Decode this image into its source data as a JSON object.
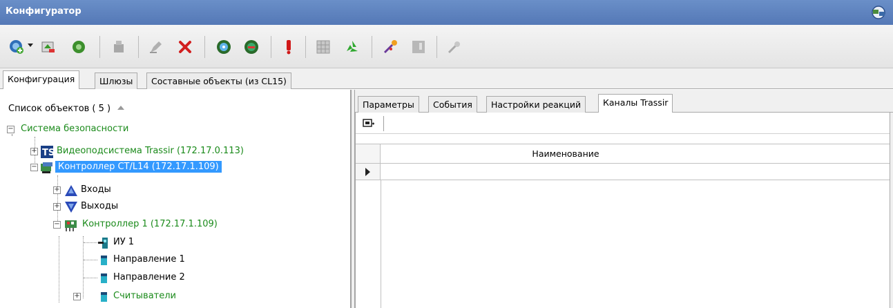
{
  "window": {
    "title": "Конфигуратор",
    "icon": "app-network-icon"
  },
  "toolbar": {
    "buttons": [
      {
        "name": "add-object-icon"
      },
      {
        "name": "import-icon"
      },
      {
        "name": "refresh-green-icon"
      },
      {
        "name": "sensor-gray-icon"
      },
      {
        "name": "edit-gray-icon"
      },
      {
        "name": "delete-icon"
      },
      {
        "name": "connect-icon"
      },
      {
        "name": "disconnect-icon"
      },
      {
        "name": "alarm-icon"
      },
      {
        "name": "grid-icon"
      },
      {
        "name": "recycle-icon"
      },
      {
        "name": "magic-icon"
      },
      {
        "name": "panel-gray-icon"
      },
      {
        "name": "tool-gray-icon"
      }
    ]
  },
  "top_tabs": [
    "Конфигурация",
    "Шлюзы",
    "Составные объекты (из CL15)"
  ],
  "object_list": {
    "header": "Список объектов ( 5 )",
    "tree": {
      "root": "Система безопасности",
      "video": "Видеоподсистема Trassir (172.17.0.113)",
      "controller": "Контроллер CT/L14 (172.17.1.109)",
      "inputs": "Входы",
      "outputs": "Выходы",
      "sub_controller": "Контроллер 1 (172.17.1.109)",
      "iu": "ИУ 1",
      "dir1": "Направление 1",
      "dir2": "Направление 2",
      "readers": "Считыватели"
    }
  },
  "right_tabs": [
    "Параметры",
    "События",
    "Настройки реакций",
    "Каналы Trassir"
  ],
  "grid": {
    "column_header": "Наименование"
  },
  "colors": {
    "title_bar": "#5a7fbd",
    "selection": "#3399ff",
    "green_text": "#1a8a1a"
  }
}
